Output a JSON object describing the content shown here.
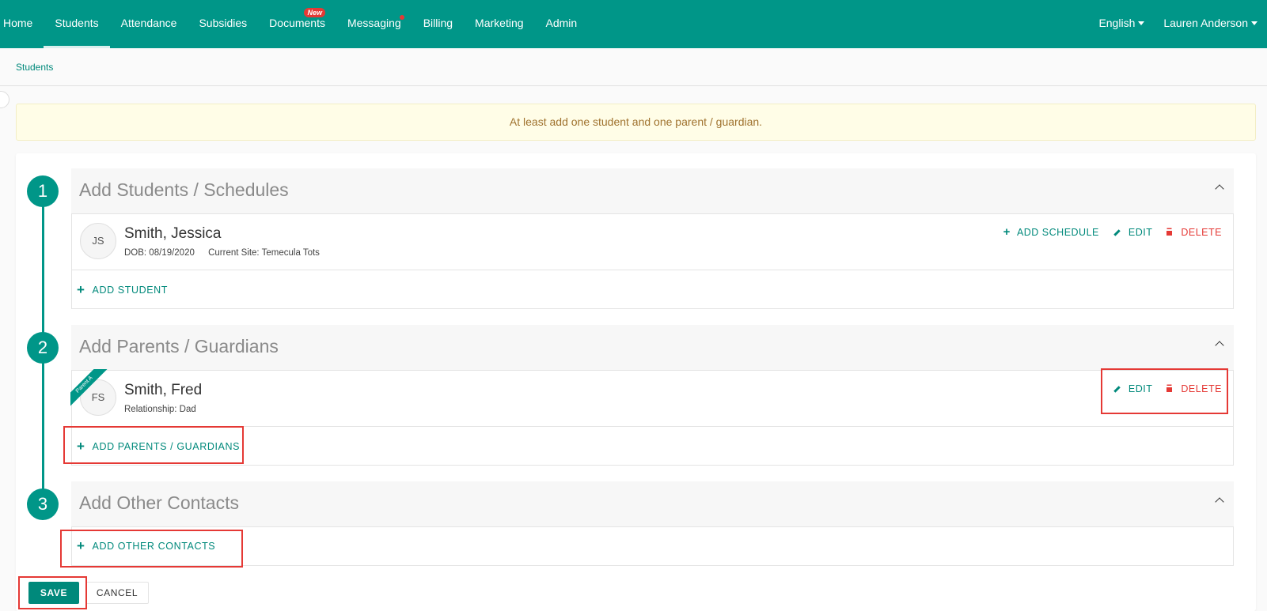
{
  "nav": {
    "items": [
      {
        "label": "Home"
      },
      {
        "label": "Students"
      },
      {
        "label": "Attendance"
      },
      {
        "label": "Subsidies"
      },
      {
        "label": "Documents",
        "badge": "New"
      },
      {
        "label": "Messaging"
      },
      {
        "label": "Billing"
      },
      {
        "label": "Marketing"
      },
      {
        "label": "Admin"
      }
    ],
    "active": "Students",
    "language": "English",
    "user": "Lauren Anderson"
  },
  "breadcrumb": "Students",
  "alert": "At least add one student and one parent / guardian.",
  "steps": [
    {
      "number": "1",
      "title": "Add Students / Schedules",
      "person": {
        "initials": "JS",
        "name": "Smith, Jessica",
        "dob": "DOB: 08/19/2020",
        "site": "Current Site: Temecula Tots"
      },
      "actions": {
        "add_schedule": "ADD SCHEDULE",
        "edit": "EDIT",
        "delete": "DELETE"
      },
      "add_label": "ADD STUDENT"
    },
    {
      "number": "2",
      "title": "Add Parents / Guardians",
      "person": {
        "initials": "FS",
        "name": "Smith, Fred",
        "relationship": "Relationship: Dad",
        "ribbon": "Parent A"
      },
      "actions": {
        "edit": "EDIT",
        "delete": "DELETE"
      },
      "add_label": "ADD PARENTS / GUARDIANS"
    },
    {
      "number": "3",
      "title": "Add Other Contacts",
      "add_label": "ADD OTHER CONTACTS"
    }
  ],
  "buttons": {
    "save": "SAVE",
    "cancel": "CANCEL"
  },
  "colors": {
    "primary": "#009688",
    "danger": "#e53935",
    "alert_bg": "#fffde7",
    "highlight": "#e53935"
  }
}
